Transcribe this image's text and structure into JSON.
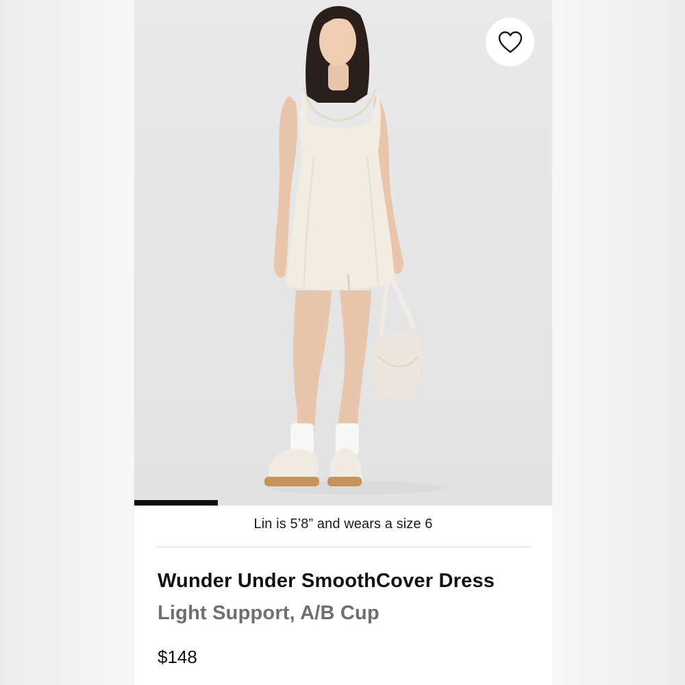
{
  "product": {
    "model_note": "Lin is 5’8” and wears a size 6",
    "name": "Wunder Under SmoothCover Dress",
    "subtitle": "Light Support, A/B Cup",
    "price": "$148"
  },
  "carousel": {
    "current_image": 1,
    "progress": 0.2
  },
  "icons": {
    "favorite": "heart-outline-icon"
  },
  "colors": {
    "photo_background": "#e7e7e7",
    "dress": "#f3ede1",
    "progress_bar": "#0d0d0d",
    "title_text": "#111111",
    "subtitle_text": "#6f6f6f"
  }
}
